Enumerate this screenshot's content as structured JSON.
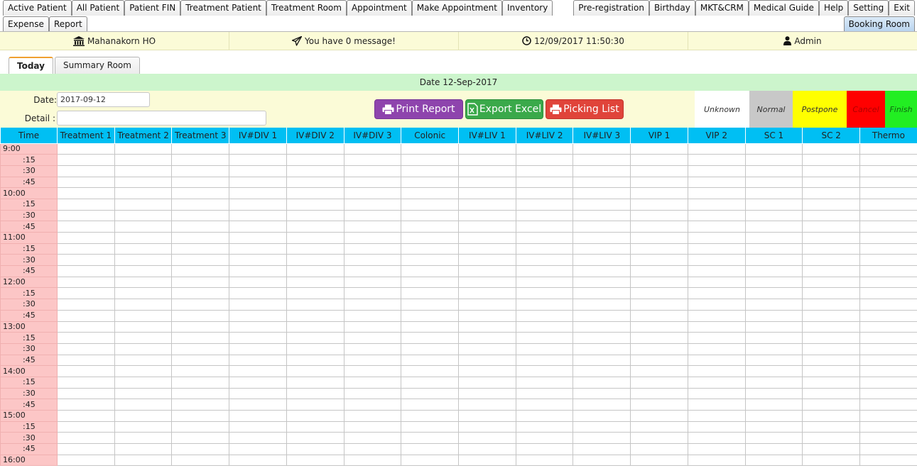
{
  "nav": {
    "row1_left": [
      "Active Patient",
      "All Patient",
      "Patient FIN",
      "Treatment Patient",
      "Treatment Room",
      "Appointment",
      "Make Appointment",
      "Inventory"
    ],
    "row1_right": [
      "Pre-registration",
      "Birthday",
      "MKT&CRM",
      "Medical Guide",
      "Help",
      "Setting",
      "Exit"
    ],
    "row2_left": [
      "Expense",
      "Report"
    ],
    "row2_right": [
      "Booking Room"
    ]
  },
  "info": {
    "branch": "Mahanakorn HO",
    "message": "You have 0 message!",
    "datetime": "12/09/2017 11:50:30",
    "user": "Admin"
  },
  "subtabs": [
    "Today",
    "Summary Room"
  ],
  "date_banner": "Date 12-Sep-2017",
  "form": {
    "date_label": "Date:",
    "date_value": "2017-09-12",
    "detail_label": "Detail :",
    "detail_value": ""
  },
  "actions": {
    "print": "Print Report",
    "excel": "Export Excel",
    "picking": "Picking List"
  },
  "legend": [
    {
      "label": "Unknown",
      "color": "#ffffff",
      "text_color": "#333333"
    },
    {
      "label": "Normal",
      "color": "#c8c8c8",
      "text_color": "#333333"
    },
    {
      "label": "Postpone",
      "color": "#ffff00",
      "text_color": "#333333"
    },
    {
      "label": "Cancel",
      "color": "#ff0000",
      "text_color": "#b00000"
    },
    {
      "label": "Finish",
      "color": "#22ee22",
      "text_color": "#116611"
    }
  ],
  "schedule": {
    "columns": [
      "Time",
      "Treatment 1",
      "Treatment 2",
      "Treatment 3",
      "IV#DIV 1",
      "IV#DIV 2",
      "IV#DIV 3",
      "Colonic",
      "IV#LIV 1",
      "IV#LIV 2",
      "IV#LIV 3",
      "VIP 1",
      "VIP 2",
      "SC 1",
      "SC 2",
      "Thermo"
    ],
    "times": [
      "9:00",
      ":15",
      ":30",
      ":45",
      "10:00",
      ":15",
      ":30",
      ":45",
      "11:00",
      ":15",
      ":30",
      ":45",
      "12:00",
      ":15",
      ":30",
      ":45",
      "13:00",
      ":15",
      ":30",
      ":45",
      "14:00",
      ":15",
      ":30",
      ":45",
      "15:00",
      ":15",
      ":30",
      ":45",
      "16:00"
    ]
  },
  "colors": {
    "header_cyan": "#00bff3",
    "info_bar": "#fbfbd7",
    "date_banner": "#ccf5cc",
    "time_cell": "#fcc6c6"
  }
}
